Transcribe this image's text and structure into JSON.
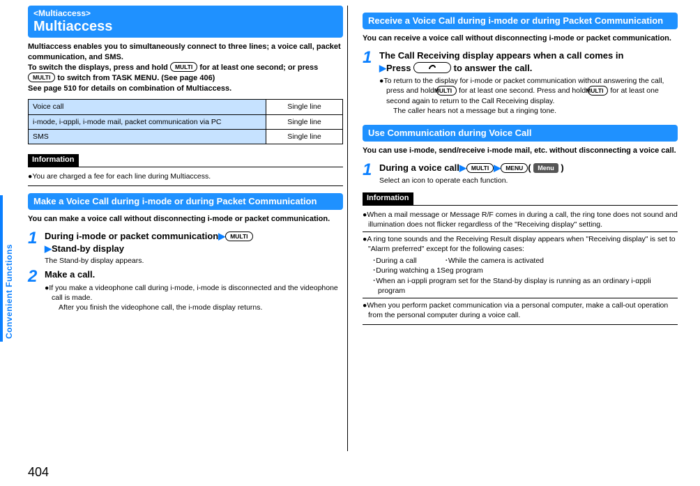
{
  "tab": {
    "label": "Convenient Functions"
  },
  "page_number": "404",
  "left": {
    "header": {
      "sup": "<Multiaccess>",
      "title": "Multiaccess"
    },
    "intro": "Multiaccess enables you to simultaneously connect to three lines; a voice call, packet communication, and SMS.\nTo switch the displays, press and hold [MULTI] for at least one second; or press [MULTI] to switch from TASK MENU. (See page 406)\nSee page 510 for details on combination of Multiaccess.",
    "intro_p1": "Multiaccess enables you to simultaneously connect to three lines; a voice call, packet communication, and SMS.",
    "intro_p2a": "To switch the displays, press and hold ",
    "intro_p2b": " for at least one second; or press ",
    "intro_p2c": " to switch from TASK MENU. (See page 406)",
    "intro_p3": "See page 510 for details on combination of Multiaccess.",
    "table": [
      {
        "name": "Voice call",
        "value": "Single line"
      },
      {
        "name": "i-mode, i-αppli, i-mode mail, packet communication via PC",
        "value": "Single line"
      },
      {
        "name": "SMS",
        "value": "Single line"
      }
    ],
    "info_label": "Information",
    "info1": "You are charged a fee for each line during Multiaccess.",
    "section1_title": "Make a Voice Call during i-mode or during Packet Communication",
    "section1_intro": "You can make a voice call without disconnecting i-mode or packet communication.",
    "step1_num": "1",
    "step1_head_a": "During i-mode or packet communication",
    "step1_head_b": "Stand-by display",
    "step1_sub": "The Stand-by display appears.",
    "step2_num": "2",
    "step2_head": "Make a call.",
    "step2_b1": "If you make a videophone call during i-mode, i-mode is disconnected and the videophone call is made.",
    "step2_b1b": "After you finish the videophone call, the i-mode display returns."
  },
  "right": {
    "section2_title": "Receive a Voice Call during i-mode or during Packet Communication",
    "section2_intro": "You can receive a voice call without disconnecting i-mode or packet communication.",
    "step1_num": "1",
    "step1_head_a": "The Call Receiving display appears when a call comes in",
    "step1_head_b_a": "Press ",
    "step1_head_b_b": " to answer the call.",
    "step1_b1a": "To return to the display for i-mode or packet communication without answering the call, press and hold ",
    "step1_b1b": " for at least one second. Press and hold ",
    "step1_b1c": " for at least one second again to return to the Call Receiving display.",
    "step1_b1d": "The caller hears not a message but a ringing tone.",
    "section3_title": "Use Communication during Voice Call",
    "section3_intro": "You can use i-mode, send/receive i-mode mail, etc. without disconnecting a voice call.",
    "step3_num": "1",
    "step3_head_a": "During a voice call",
    "step3_sub": "Select an icon to operate each function.",
    "info_label": "Information",
    "info_items": {
      "i1": "When a mail message or Message R/F comes in during a call, the ring tone does not sound and illumination does not flicker regardless of the \"Receiving display\" setting.",
      "i2": "A ring tone sounds and the Receiving Result display appears when \"Receiving display\" is set to \"Alarm preferred\" except for the following cases:",
      "i2a": "During a call",
      "i2b": "While the camera is activated",
      "i2c": "During watching a 1Seg program",
      "i2d": "When an i-αppli program set for the Stand-by display is running as an ordinary i-αppli program",
      "i3": "When you perform packet communication via a personal computer, make a call-out operation from the personal computer during a voice call."
    }
  },
  "keys": {
    "multi": "MULTI",
    "menu": "MENU",
    "menulabel": "Menu"
  }
}
